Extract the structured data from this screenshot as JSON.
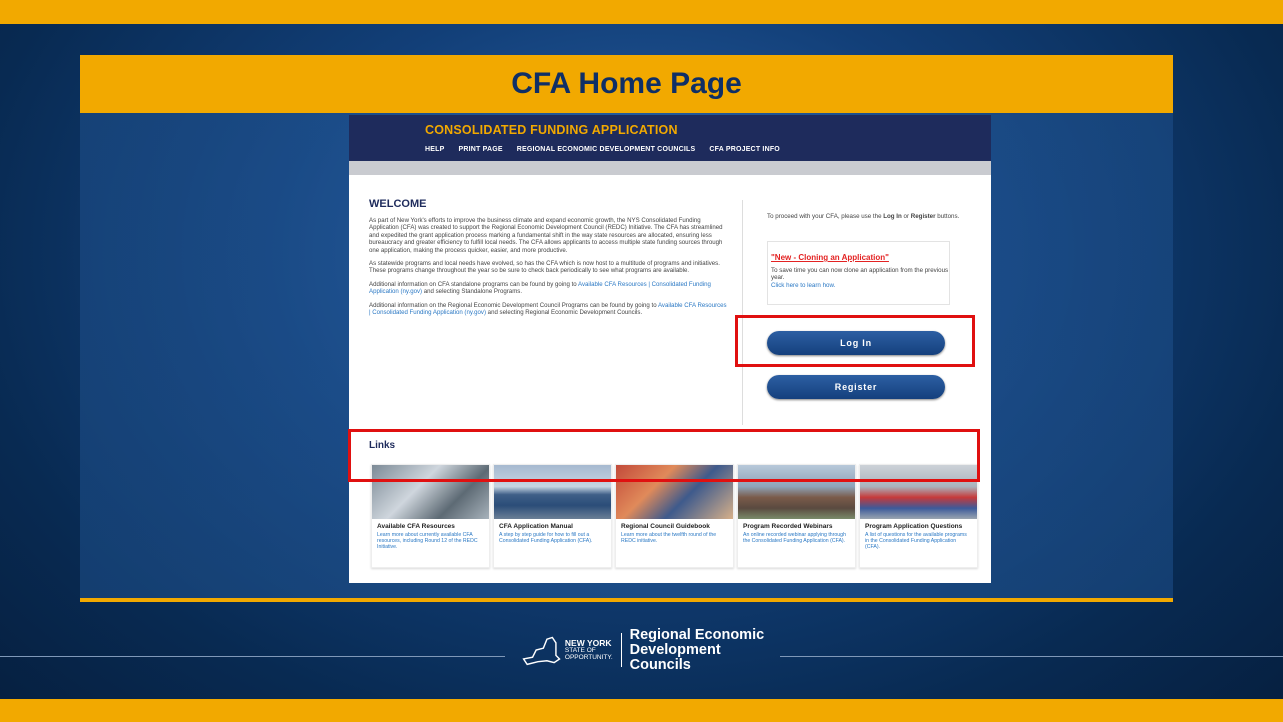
{
  "slide": {
    "title": "CFA Home Page"
  },
  "site": {
    "brand": "CONSOLIDATED FUNDING APPLICATION",
    "nav": [
      "HELP",
      "PRINT PAGE",
      "REGIONAL ECONOMIC DEVELOPMENT COUNCILS",
      "CFA PROJECT INFO"
    ]
  },
  "welcome": {
    "heading": "WELCOME",
    "p1": "As part of New York's efforts to improve the business climate and expand economic growth, the NYS Consolidated Funding Application (CFA) was created to support the Regional Economic Development Council (REDC) Initiative. The CFA has streamlined and expedited the grant application process marking a fundamental shift in the way state resources are allocated, ensuring less bureaucracy and greater efficiency to fulfill local needs. The CFA allows applicants to access multiple state funding sources through one application, making the process quicker, easier, and more productive.",
    "p2": "As statewide programs and local needs have evolved, so has the CFA which is now host to a multitude of programs and initiatives. These programs change throughout the year so be sure to check back periodically to see what programs are available.",
    "p3_pre": "Additional information on CFA standalone programs can be found by going to ",
    "p3_link": "Available CFA Resources | Consolidated Funding Application (ny.gov)",
    "p3_post": " and selecting Standalone Programs.",
    "p4_pre": "Additional information on the Regional Economic Development Council Programs can be found by going to ",
    "p4_link": "Available CFA Resources | Consolidated Funding Application (ny.gov)",
    "p4_post": " and selecting Regional Economic Development Councils."
  },
  "right": {
    "proceed_pre": "To proceed with your CFA, please use the ",
    "proceed_login": "Log In",
    "proceed_mid": " or ",
    "proceed_register": "Register",
    "proceed_post": " buttons.",
    "clone_title": "\"New - Cloning an Application\"",
    "clone_text": "To save time you can now clone an application from the previous year.",
    "clone_link": "Click here to learn how.",
    "login_label": "Log In",
    "register_label": "Register"
  },
  "links": {
    "heading": "Links",
    "cards": [
      {
        "title": "Available CFA Resources",
        "desc": "Learn more about currently available CFA resources, including Round 12 of the REDC Initiative."
      },
      {
        "title": "CFA Application Manual",
        "desc": "A step by step guide for how to fill out a Consolidated Funding Application (CFA)."
      },
      {
        "title": "Regional Council Guidebook",
        "desc": "Learn more about the twelfth round of the REDC initiative."
      },
      {
        "title": "Program Recorded Webinars",
        "desc": "An online recorded webinar applying through the Consolidated Funding Application (CFA)."
      },
      {
        "title": "Program Application Questions",
        "desc": "A list of questions for the available programs in the Consolidated Funding Application (CFA)."
      }
    ]
  },
  "footer": {
    "nys_line1": "NEW YORK",
    "nys_line2": "STATE OF",
    "nys_line3": "OPPORTUNITY.",
    "redc_line1": "Regional Economic",
    "redc_line2": "Development Councils"
  },
  "colors": {
    "gold": "#f2a900",
    "navy": "#1e2b5c",
    "highlight_red": "#e01010",
    "link_blue": "#2a78c4"
  }
}
